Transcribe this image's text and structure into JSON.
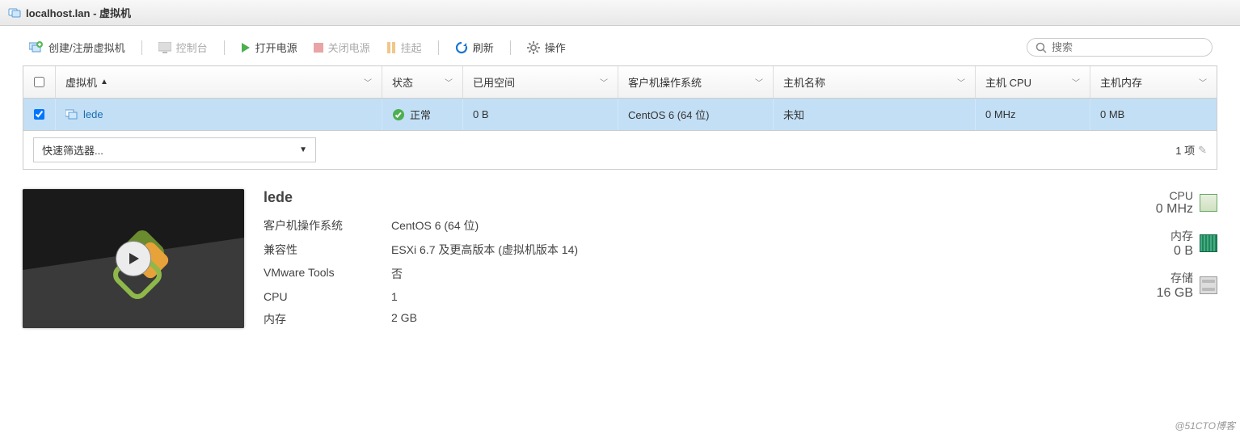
{
  "header": {
    "title": "localhost.lan - 虚拟机"
  },
  "toolbar": {
    "create": "创建/注册虚拟机",
    "console": "控制台",
    "power_on": "打开电源",
    "power_off": "关闭电源",
    "suspend": "挂起",
    "refresh": "刷新",
    "actions": "操作",
    "search_placeholder": "搜索"
  },
  "table": {
    "headers": {
      "vm": "虚拟机",
      "status": "状态",
      "space": "已用空间",
      "os": "客户机操作系统",
      "hostname": "主机名称",
      "cpu": "主机 CPU",
      "mem": "主机内存"
    },
    "rows": [
      {
        "name": "lede",
        "status": "正常",
        "space": "0 B",
        "os": "CentOS 6 (64 位)",
        "hostname": "未知",
        "cpu": "0 MHz",
        "mem": "0 MB",
        "checked": true
      }
    ],
    "filter": "快速筛选器...",
    "count": "1 项"
  },
  "details": {
    "name": "lede",
    "labels": {
      "os": "客户机操作系统",
      "compat": "兼容性",
      "tools": "VMware Tools",
      "cpu": "CPU",
      "mem": "内存"
    },
    "values": {
      "os": "CentOS 6 (64 位)",
      "compat": "ESXi 6.7 及更高版本 (虚拟机版本 14)",
      "tools": "否",
      "cpu": "1",
      "mem": "2 GB"
    }
  },
  "stats": {
    "cpu_label": "CPU",
    "cpu_val": "0 MHz",
    "mem_label": "内存",
    "mem_val": "0 B",
    "disk_label": "存储",
    "disk_val": "16 GB"
  },
  "watermark": "@51CTO博客"
}
